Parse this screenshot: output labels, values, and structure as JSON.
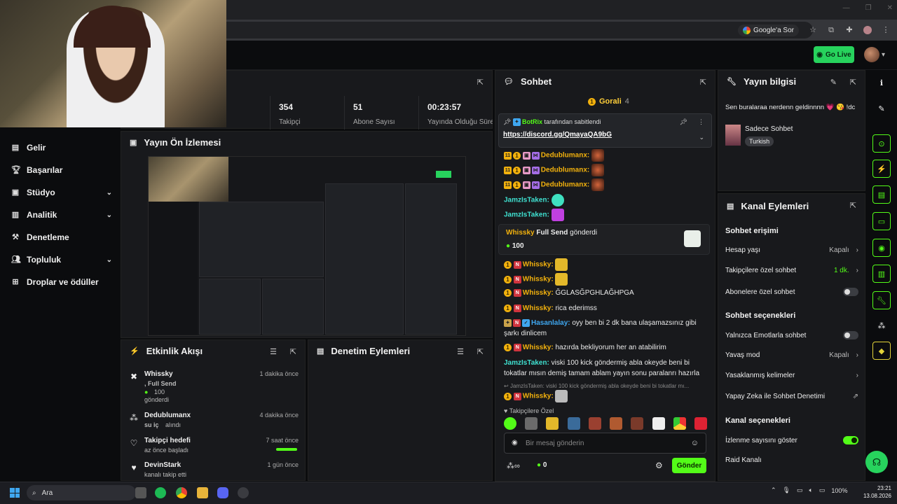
{
  "browser": {
    "google_sor": "Google'a Sor"
  },
  "header": {
    "go_live": "Go Live"
  },
  "nav": {
    "items": [
      {
        "label": "Gelir",
        "icon": "money-icon"
      },
      {
        "label": "Başarılar",
        "icon": "trophy-icon"
      },
      {
        "label": "Stüdyo",
        "icon": "studio-icon"
      },
      {
        "label": "Analitik",
        "icon": "analytics-icon"
      },
      {
        "label": "Denetleme",
        "icon": "hammer-icon"
      },
      {
        "label": "Topluluk",
        "icon": "community-icon"
      },
      {
        "label": "Droplar ve ödüller",
        "icon": "drops-icon"
      }
    ]
  },
  "stats": [
    {
      "value": "354",
      "label": "Takipçi"
    },
    {
      "value": "51",
      "label": "Abone Sayısı"
    },
    {
      "value": "00:23:57",
      "label": "Yayında Olduğu Süre"
    }
  ],
  "preview": {
    "title": "Yayın Ön İzlemesi"
  },
  "activity": {
    "title": "Etkinlik Akışı",
    "items": [
      {
        "name": "Whissky",
        "time": "1 dakika önce",
        "line1": ", Full Send",
        "line2": "100",
        "line3": "gönderdi"
      },
      {
        "name": "Dedublumanx",
        "time": "4 dakika önce",
        "line1": "su iç",
        "line2": "alındı"
      },
      {
        "name": "Takipçi hedefi",
        "time": "7 saat önce",
        "line1": "az önce başladı"
      },
      {
        "name": "DevinStark",
        "time": "1 gün önce",
        "line1": "kanalı takip etti"
      }
    ]
  },
  "moderation": {
    "title": "Denetim Eylemleri"
  },
  "chat": {
    "title": "Sohbet",
    "top_gifter": "Gorali",
    "top_gifter_count": "4",
    "pinned_by": "BotRix",
    "pinned_suffix": "tarafından sabitlendi",
    "pinned_link": "https://discord.gg/QmayaQA9bG",
    "messages": [
      {
        "user": "Dedublumanx:",
        "text": ""
      },
      {
        "user": "Dedublumanx:",
        "text": ""
      },
      {
        "user": "Dedublumanx:",
        "text": ""
      },
      {
        "user": "JamzIsTaken:",
        "text": ""
      },
      {
        "user": "JamzIsTaken:",
        "text": ""
      }
    ],
    "gift": {
      "user": "Whissky",
      "item": "Full Send",
      "suffix": "gönderdi",
      "amount": "100"
    },
    "messages2": [
      {
        "user": "Whissky:",
        "text": ""
      },
      {
        "user": "Whissky:",
        "text": ""
      },
      {
        "user": "Whissky:",
        "text": "ĞGLASĞPGHLAĞHPGA"
      },
      {
        "user": "Whissky:",
        "text": "rica ederimss"
      },
      {
        "user": "Hasanlalay:",
        "text": "oyy ben bi 2 dk bana ulaşamazsınız gibi şarkı dinlicem"
      },
      {
        "user": "Whissky:",
        "text": "hazırda bekliyorum her an atabilirim"
      },
      {
        "user": "JamzIsTaken:",
        "text": "viski 100 kick göndermiş abla okeyde beni bi tokatlar mısın demiş tamam ablam yayın sonu paralanrı hazırla"
      }
    ],
    "reply_preview": "JamzIsTaken: viski 100 kick göndermiş abla okeyde beni bi tokatlar mı...",
    "last_user": "Whissky:",
    "followers_only": "Takipçilere Özel",
    "placeholder": "Bir mesaj gönderin",
    "points": "0",
    "send": "Gönder"
  },
  "info": {
    "title": "Yayın bilgisi",
    "stream_title": "Sen buralaraa nerdenn geldinnnn 💗 😘 !dc",
    "category": "Sadece Sohbet",
    "language": "Turkish"
  },
  "actions": {
    "title": "Kanal Eylemleri",
    "sec1": "Sohbet erişimi",
    "hesap_yasi": "Hesap yaşı",
    "hesap_yasi_v": "Kapalı",
    "takipci": "Takipçilere özel sohbet",
    "takipci_v": "1 dk.",
    "abone": "Abonelere özel sohbet",
    "sec2": "Sohbet seçenekleri",
    "emote": "Yalnızca Emotlarla sohbet",
    "yavas": "Yavaş mod",
    "yavas_v": "Kapalı",
    "yasak": "Yasaklanmış kelimeler",
    "ai": "Yapay Zeka ile Sohbet Denetimi",
    "sec3": "Kanal seçenekleri",
    "izlenme": "İzlenme sayısını göster",
    "raid": "Raid Kanalı"
  },
  "taskbar": {
    "search": "Ara",
    "battery": "100%",
    "time": "23:21",
    "date": "13.08.2026"
  },
  "colors": {
    "accent": "#53fc18",
    "panel": "#18191c",
    "bg": "#0b0c0e",
    "coin": "#f2b10d"
  }
}
